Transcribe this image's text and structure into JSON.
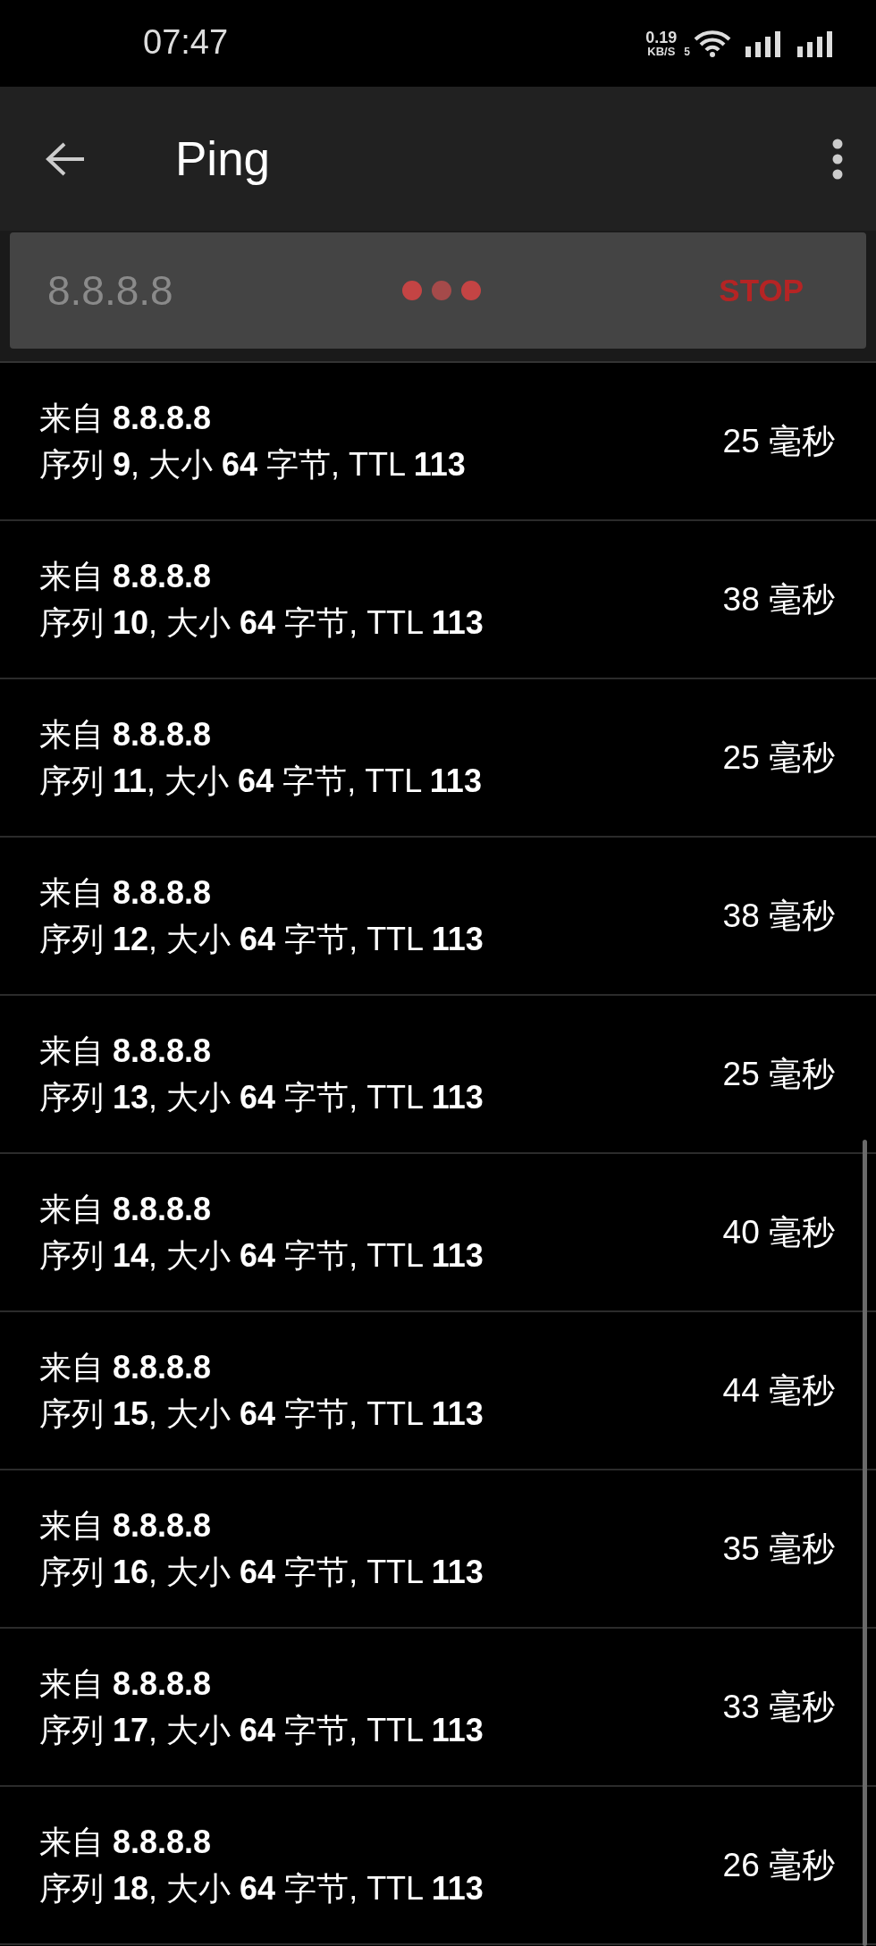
{
  "status_bar": {
    "time": "07:47",
    "speed_value": "0.19",
    "speed_unit": "KB/S",
    "wifi_badge": "5"
  },
  "app_bar": {
    "title": "Ping"
  },
  "ping_bar": {
    "host": "8.8.8.8",
    "running": true,
    "action": "STOP"
  },
  "results": [
    {
      "line1": "来自 **8.8.8.8**",
      "line2": "序列 **9**, 大小 **64** 字节, TTL **113**",
      "time": "25 毫秒"
    },
    {
      "line1": "来自 **8.8.8.8**",
      "line2": "序列 **10**, 大小 **64** 字节, TTL **113**",
      "time": "38 毫秒"
    },
    {
      "line1": "来自 **8.8.8.8**",
      "line2": "序列 **11**, 大小 **64** 字节, TTL **113**",
      "time": "25 毫秒"
    },
    {
      "line1": "来自 **8.8.8.8**",
      "line2": "序列 **12**, 大小 **64** 字节, TTL **113**",
      "time": "38 毫秒"
    },
    {
      "line1": "来自 **8.8.8.8**",
      "line2": "序列 **13**, 大小 **64** 字节, TTL **113**",
      "time": "25 毫秒"
    },
    {
      "line1": "来自 **8.8.8.8**",
      "line2": "序列 **14**, 大小 **64** 字节, TTL **113**",
      "time": "40 毫秒"
    },
    {
      "line1": "来自 **8.8.8.8**",
      "line2": "序列 **15**, 大小 **64** 字节, TTL **113**",
      "time": "44 毫秒"
    },
    {
      "line1": "来自 **8.8.8.8**",
      "line2": "序列 **16**, 大小 **64** 字节, TTL **113**",
      "time": "35 毫秒"
    },
    {
      "line1": "来自 **8.8.8.8**",
      "line2": "序列 **17**, 大小 **64** 字节, TTL **113**",
      "time": "33 毫秒"
    },
    {
      "line1": "来自 **8.8.8.8**",
      "line2": "序列 **18**, 大小 **64** 字节, TTL **113**",
      "time": "26 毫秒"
    }
  ]
}
